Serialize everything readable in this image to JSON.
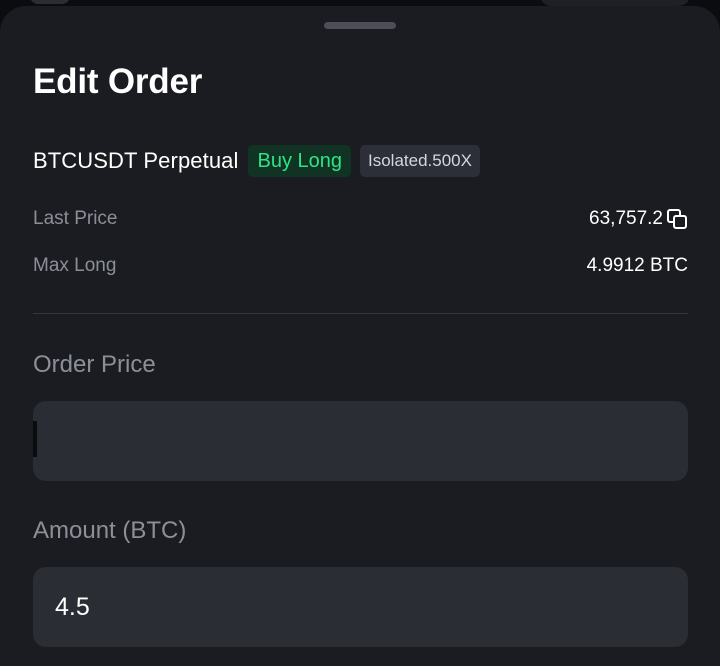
{
  "sheet": {
    "title": "Edit Order"
  },
  "contract": {
    "name": "BTCUSDT Perpetual",
    "side": "Buy Long",
    "margin_mode": "Isolated.500X"
  },
  "info": {
    "last_price_label": "Last Price",
    "last_price_value": "63,757.2",
    "max_long_label": "Max Long",
    "max_long_value": "4.9912 BTC"
  },
  "order_price": {
    "label": "Order Price",
    "value": ""
  },
  "amount": {
    "label": "Amount (BTC)",
    "value": "4.5"
  },
  "icons": {
    "copy": "copy-icon"
  },
  "colors": {
    "sheet_bg": "#1b1c21",
    "buy_green": "#2ee584",
    "buy_badge_bg": "#113324",
    "input_bg": "#2a2d34"
  }
}
